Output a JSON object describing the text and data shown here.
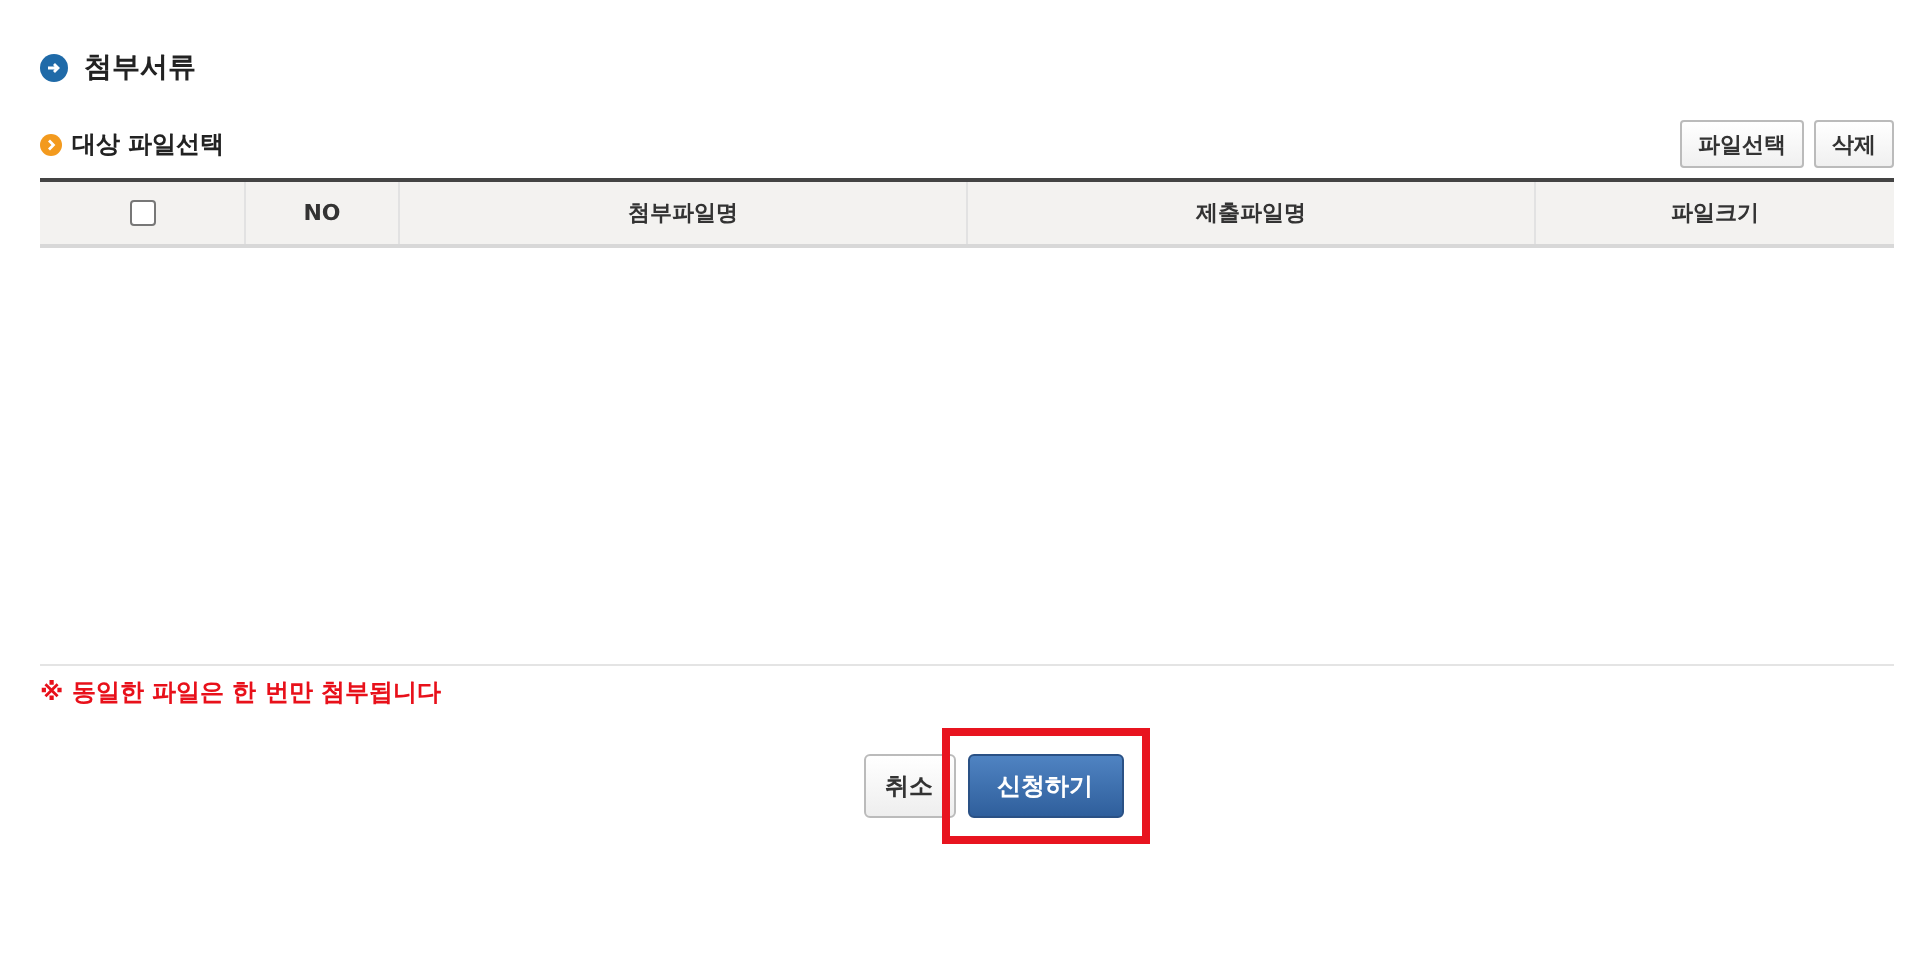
{
  "section_title": "첨부서류",
  "subsection_title": "대상 파일선택",
  "toolbar_buttons": [
    "파일선택",
    "삭제"
  ],
  "table": {
    "select_all": {
      "checked": false
    },
    "columns": [
      {
        "kind": "checkbox"
      },
      {
        "kind": "text",
        "label": "NO"
      },
      {
        "kind": "text",
        "label": "첨부파일명"
      },
      {
        "kind": "text",
        "label": "제출파일명"
      },
      {
        "kind": "text",
        "label": "파일크기"
      }
    ]
  },
  "note": "※ 동일한 파일은 한 번만 첨부됩니다",
  "actions": [
    {
      "kind": "secondary",
      "label": "취소",
      "highlighted": false
    },
    {
      "kind": "primary",
      "label": "신청하기",
      "highlighted": true
    }
  ]
}
